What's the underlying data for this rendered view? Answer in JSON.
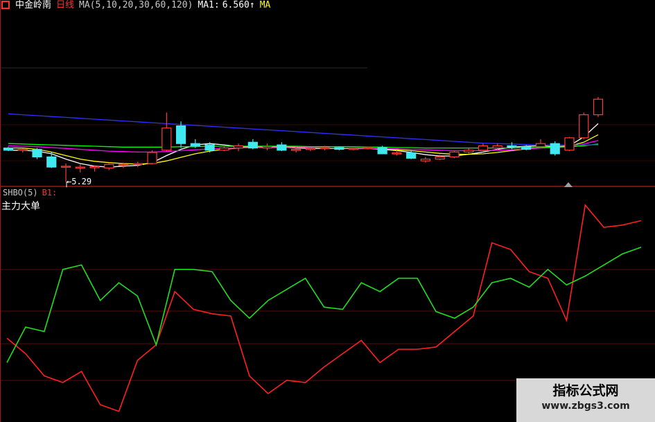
{
  "header": {
    "stock_name": "中金岭南",
    "period": "日线",
    "ma_params": "MA(5,10,20,30,60,120)",
    "ma1_label": "MA1:",
    "ma1_value": "6.560",
    "ma1_arrow": "↑",
    "ma2_label": "MA",
    "colors": {
      "name": "#ffffff",
      "period": "#ff3030",
      "ma": "#c8c8c8",
      "ma1": "#ffffff",
      "ma2": "#ffff00"
    }
  },
  "main_panel": {
    "low_label": "←5.29"
  },
  "indicator": {
    "name": "SHBO(5)",
    "b1": "B1:",
    "title": "主力大单"
  },
  "watermark": {
    "title": "指标公式网",
    "url": "www.zbgs3.com"
  },
  "chart_data": [
    {
      "type": "candlestick",
      "title": "",
      "price_range": [
        5.2,
        7.2
      ],
      "candles": [
        {
          "o": 6.05,
          "h": 6.08,
          "l": 5.98,
          "c": 6.0
        },
        {
          "o": 6.0,
          "h": 6.04,
          "l": 5.95,
          "c": 6.02
        },
        {
          "o": 6.02,
          "h": 6.05,
          "l": 5.8,
          "c": 5.85
        },
        {
          "o": 5.85,
          "h": 5.95,
          "l": 5.6,
          "c": 5.62
        },
        {
          "o": 5.62,
          "h": 5.7,
          "l": 5.29,
          "c": 5.64
        },
        {
          "o": 5.62,
          "h": 5.68,
          "l": 5.5,
          "c": 5.62
        },
        {
          "o": 5.62,
          "h": 5.66,
          "l": 5.52,
          "c": 5.63
        },
        {
          "o": 5.6,
          "h": 5.7,
          "l": 5.55,
          "c": 5.68
        },
        {
          "o": 5.66,
          "h": 5.72,
          "l": 5.6,
          "c": 5.68
        },
        {
          "o": 5.68,
          "h": 5.74,
          "l": 5.62,
          "c": 5.7
        },
        {
          "o": 5.7,
          "h": 6.0,
          "l": 5.68,
          "c": 5.95
        },
        {
          "o": 6.0,
          "h": 6.85,
          "l": 5.98,
          "c": 6.5
        },
        {
          "o": 6.55,
          "h": 6.65,
          "l": 6.05,
          "c": 6.15
        },
        {
          "o": 6.15,
          "h": 6.25,
          "l": 6.05,
          "c": 6.1
        },
        {
          "o": 6.12,
          "h": 6.18,
          "l": 5.95,
          "c": 6.0
        },
        {
          "o": 6.0,
          "h": 6.1,
          "l": 5.98,
          "c": 6.05
        },
        {
          "o": 6.05,
          "h": 6.15,
          "l": 5.98,
          "c": 6.1
        },
        {
          "o": 6.18,
          "h": 6.25,
          "l": 6.02,
          "c": 6.05
        },
        {
          "o": 6.05,
          "h": 6.15,
          "l": 6.0,
          "c": 6.08
        },
        {
          "o": 6.12,
          "h": 6.18,
          "l": 5.98,
          "c": 6.0
        },
        {
          "o": 6.0,
          "h": 6.08,
          "l": 5.95,
          "c": 6.02
        },
        {
          "o": 6.02,
          "h": 6.06,
          "l": 5.98,
          "c": 6.04
        },
        {
          "o": 6.04,
          "h": 6.1,
          "l": 6.0,
          "c": 6.06
        },
        {
          "o": 6.06,
          "h": 6.08,
          "l": 6.0,
          "c": 6.02
        },
        {
          "o": 6.02,
          "h": 6.06,
          "l": 6.0,
          "c": 6.04
        },
        {
          "o": 6.04,
          "h": 6.08,
          "l": 6.02,
          "c": 6.06
        },
        {
          "o": 6.06,
          "h": 6.1,
          "l": 5.95,
          "c": 5.92
        },
        {
          "o": 5.92,
          "h": 6.0,
          "l": 5.88,
          "c": 5.94
        },
        {
          "o": 5.94,
          "h": 5.98,
          "l": 5.8,
          "c": 5.82
        },
        {
          "o": 5.76,
          "h": 5.85,
          "l": 5.72,
          "c": 5.8
        },
        {
          "o": 5.8,
          "h": 5.9,
          "l": 5.78,
          "c": 5.85
        },
        {
          "o": 5.85,
          "h": 5.98,
          "l": 5.82,
          "c": 5.96
        },
        {
          "o": 5.96,
          "h": 6.05,
          "l": 5.92,
          "c": 6.0
        },
        {
          "o": 6.0,
          "h": 6.15,
          "l": 5.98,
          "c": 6.1
        },
        {
          "o": 6.05,
          "h": 6.15,
          "l": 6.0,
          "c": 6.1
        },
        {
          "o": 6.1,
          "h": 6.18,
          "l": 6.02,
          "c": 6.08
        },
        {
          "o": 6.08,
          "h": 6.12,
          "l": 6.0,
          "c": 6.02
        },
        {
          "o": 6.08,
          "h": 6.25,
          "l": 6.05,
          "c": 6.15
        },
        {
          "o": 6.15,
          "h": 6.2,
          "l": 5.88,
          "c": 5.92
        },
        {
          "o": 6.0,
          "h": 6.3,
          "l": 5.98,
          "c": 6.28
        },
        {
          "o": 6.28,
          "h": 6.85,
          "l": 6.25,
          "c": 6.8
        },
        {
          "o": 6.8,
          "h": 7.2,
          "l": 6.75,
          "c": 7.15
        }
      ],
      "ma_series": [
        {
          "color": "#ffffff",
          "values": [
            6.0,
            6.0,
            5.98,
            5.92,
            5.8,
            5.7,
            5.64,
            5.62,
            5.64,
            5.66,
            5.72,
            5.88,
            6.02,
            6.12,
            6.15,
            6.12,
            6.08,
            6.08,
            6.08,
            6.07,
            6.05,
            6.04,
            6.04,
            6.04,
            6.04,
            6.04,
            6.02,
            5.99,
            5.95,
            5.9,
            5.87,
            5.87,
            5.91,
            5.96,
            6.02,
            6.07,
            6.09,
            6.1,
            6.08,
            6.1,
            6.3,
            6.6
          ]
        },
        {
          "color": "#ffff00",
          "values": [
            6.05,
            6.05,
            6.02,
            5.96,
            5.88,
            5.8,
            5.75,
            5.72,
            5.7,
            5.69,
            5.7,
            5.76,
            5.84,
            5.92,
            5.98,
            6.02,
            6.05,
            6.07,
            6.08,
            6.08,
            6.07,
            6.06,
            6.05,
            6.05,
            6.05,
            6.04,
            6.03,
            6.01,
            5.99,
            5.96,
            5.93,
            5.91,
            5.91,
            5.92,
            5.95,
            5.99,
            6.03,
            6.06,
            6.07,
            6.09,
            6.18,
            6.35
          ]
        },
        {
          "color": "#ff00ff",
          "values": [
            6.1,
            6.09,
            6.08,
            6.06,
            6.04,
            6.02,
            6.0,
            5.98,
            5.97,
            5.96,
            5.96,
            5.97,
            5.99,
            6.01,
            6.03,
            6.04,
            6.05,
            6.06,
            6.06,
            6.06,
            6.06,
            6.06,
            6.05,
            6.05,
            6.05,
            6.04,
            6.04,
            6.03,
            6.02,
            6.01,
            6.0,
            5.99,
            5.99,
            5.99,
            6.0,
            6.01,
            6.03,
            6.05,
            6.06,
            6.08,
            6.14,
            6.22
          ]
        },
        {
          "color": "#00ff00",
          "values": [
            6.15,
            6.14,
            6.13,
            6.12,
            6.11,
            6.1,
            6.09,
            6.08,
            6.07,
            6.07,
            6.07,
            6.07,
            6.08,
            6.08,
            6.09,
            6.09,
            6.09,
            6.09,
            6.09,
            6.09,
            6.09,
            6.08,
            6.08,
            6.08,
            6.08,
            6.07,
            6.07,
            6.06,
            6.06,
            6.05,
            6.05,
            6.05,
            6.05,
            6.05,
            6.05,
            6.05,
            6.06,
            6.06,
            6.07,
            6.08,
            6.1,
            6.14
          ]
        },
        {
          "color": "#3030ff",
          "values": [
            6.82,
            6.8,
            6.78,
            6.76,
            6.74,
            6.72,
            6.7,
            6.68,
            6.66,
            6.64,
            6.62,
            6.6,
            6.58,
            6.56,
            6.54,
            6.52,
            6.5,
            6.48,
            6.46,
            6.44,
            6.42,
            6.4,
            6.38,
            6.36,
            6.34,
            6.32,
            6.3,
            6.28,
            6.26,
            6.24,
            6.22,
            6.2,
            6.18,
            6.16,
            6.15,
            6.14,
            6.13,
            6.12,
            6.12,
            6.12,
            6.12,
            6.12
          ]
        }
      ],
      "low_marker": 5.29
    },
    {
      "type": "line",
      "title": "主力大单",
      "y_range": [
        0,
        100
      ],
      "series": [
        {
          "color": "#ff2020",
          "values": [
            35,
            28,
            18,
            15,
            20,
            5,
            2,
            25,
            32,
            56,
            48,
            46,
            45,
            18,
            10,
            16,
            15,
            22,
            28,
            34,
            24,
            30,
            30,
            31,
            38,
            45,
            78,
            75,
            65,
            62,
            43,
            95,
            85,
            86,
            88
          ]
        },
        {
          "color": "#20e020",
          "values": [
            24,
            40,
            38,
            66,
            68,
            52,
            60,
            54,
            32,
            66,
            66,
            65,
            52,
            44,
            52,
            57,
            62,
            49,
            48,
            60,
            56,
            62,
            62,
            47,
            44,
            49,
            60,
            62,
            58,
            66,
            59,
            63,
            68,
            73,
            76
          ]
        }
      ]
    }
  ]
}
